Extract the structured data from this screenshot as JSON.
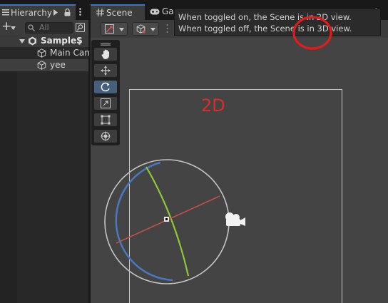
{
  "hierarchy": {
    "tab_label": "Hierarchy",
    "add_label": "+",
    "search_placeholder": "All",
    "items": [
      {
        "label": "SampleS",
        "level": 0
      },
      {
        "label": "Main Can",
        "level": 1
      },
      {
        "label": "yee",
        "level": 1
      }
    ]
  },
  "scene": {
    "tabs": [
      {
        "label": "Scene"
      },
      {
        "label": "Game"
      }
    ],
    "toolbar": {
      "mode_2d_label": "2D"
    },
    "tooltip": "When toggled on, the Scene is in 2D view. When toggled off, the Scene is in 3D view.",
    "canvas_label": "2D",
    "highlight_color": "#e31b1b",
    "tools": [
      "hand-tool",
      "move-tool",
      "rotate-tool",
      "scale-tool",
      "rect-tool",
      "transform-tool"
    ],
    "active_tool_index": 2
  }
}
